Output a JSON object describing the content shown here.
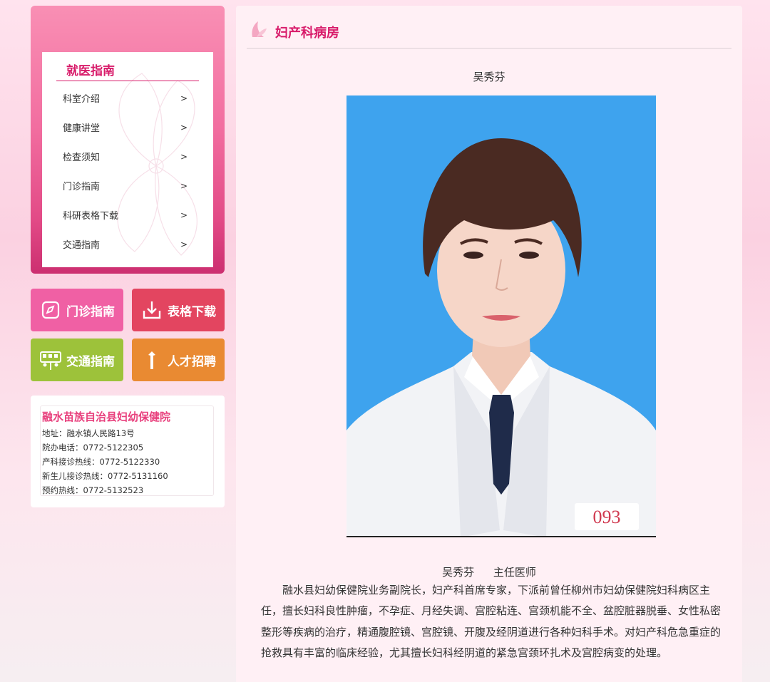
{
  "sidebar": {
    "title": "就医指南",
    "items": [
      {
        "label": "科室介绍",
        "arrow": ">"
      },
      {
        "label": "健康讲堂",
        "arrow": ">"
      },
      {
        "label": "检查须知",
        "arrow": ">"
      },
      {
        "label": "门诊指南",
        "arrow": ">"
      },
      {
        "label": "科研表格下载",
        "arrow": ">"
      },
      {
        "label": "交通指南",
        "arrow": ">"
      }
    ]
  },
  "quick_links": [
    {
      "label": "门诊指南",
      "icon": "compass-icon",
      "color": "#f060a4"
    },
    {
      "label": "表格下载",
      "icon": "download-icon",
      "color": "#e34560"
    },
    {
      "label": "交通指南",
      "icon": "bus-icon",
      "color": "#9dc23a"
    },
    {
      "label": "人才招聘",
      "icon": "person-icon",
      "color": "#e98a32"
    }
  ],
  "contact": {
    "name": "融水苗族自治县妇幼保健院",
    "address": "地址：融水镇人民路13号",
    "office_phone": "院办电话：0772-5122305",
    "obstetrics_hotline": "产科接诊热线：0772-5122330",
    "newborn_hotline": "新生儿接诊热线：0772-5131160",
    "appointment_hotline": "预约热线：0772-5132523"
  },
  "main": {
    "title": "妇产科病房",
    "doctor_name_top": "吴秀芬",
    "caption_name": "吴秀芬",
    "caption_title": "主任医师",
    "photo_badge": "093",
    "bio": "融水县妇幼保健院业务副院长，妇产科首席专家，下派前曾任柳州市妇幼保健院妇科病区主任，擅长妇科良性肿瘤，不孕症、月经失调、宫腔粘连、宫颈机能不全、盆腔脏器脱垂、女性私密整形等疾病的治疗，精通腹腔镜、宫腔镜、开腹及经阴道进行各种妇科手术。对妇产科危急重症的抢救具有丰富的临床经验，尤其擅长妇科经阴道的紧急宫颈环扎术及宫腔病变的处理。"
  },
  "colors": {
    "accent": "#d81b6a",
    "photo_bg": "#3ea3ee"
  }
}
